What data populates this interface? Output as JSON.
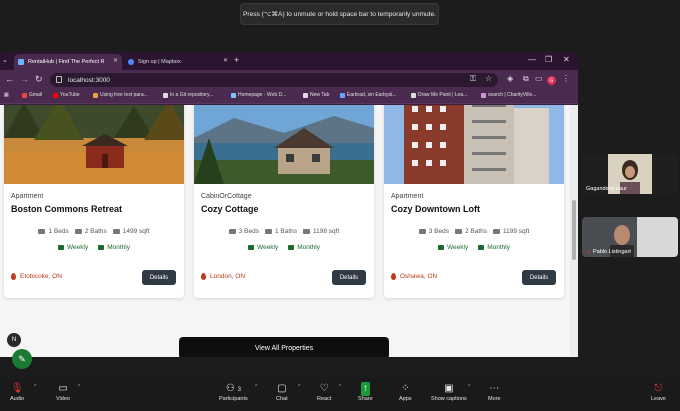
{
  "notification": "Press (⌥⌘A) to unmute or hold space bar to temporarily unmute.",
  "browser": {
    "tabs": [
      {
        "label": "RentalHub | Find The Perfect R",
        "active": true
      },
      {
        "label": "Sign up | Mapbox",
        "active": false
      }
    ],
    "url": "localhost:3000",
    "profile_initial": "G",
    "bookmarks": [
      "Gmail",
      "YouTube",
      "Using free text para...",
      "In a Git repository...",
      "Homepage - Web D...",
      "New Tab",
      "Earbrad, sin Earbyal...",
      "Draw Me Paint | Lea...",
      "search | CharityVille..."
    ]
  },
  "cards": [
    {
      "type": "Apartment",
      "title": "Boston Commons Retreat",
      "beds": "1 Beds",
      "baths": "2 Baths",
      "sqft": "1499 sqft",
      "rate1": "Weekly",
      "rate2": "Monthly",
      "location": "Etobicoke, ON",
      "button": "Details"
    },
    {
      "type": "CabinOrCottage",
      "title": "Cozy Cottage",
      "beds": "3 Beds",
      "baths": "1 Baths",
      "sqft": "1198 sqft",
      "rate1": "Weekly",
      "rate2": "Monthly",
      "location": "London, ON",
      "button": "Details"
    },
    {
      "type": "Apartment",
      "title": "Cozy Downtown Loft",
      "beds": "3 Beds",
      "baths": "2 Baths",
      "sqft": "1199 sqft",
      "rate1": "Weekly",
      "rate2": "Monthly",
      "location": "Oshawa, ON",
      "button": "Details"
    }
  ],
  "view_all": "View All Properties",
  "participants": [
    {
      "name": "Gagandeep kaur"
    },
    {
      "name": "Pablo Listingart"
    }
  ],
  "floating": {
    "n_label": "N"
  },
  "toolbar": {
    "audio": "Audio",
    "video": "Video",
    "participants": "Participants",
    "participants_count": "3",
    "chat": "Chat",
    "react": "React",
    "share": "Share",
    "apps": "Apps",
    "captions": "Show captions",
    "more": "More",
    "leave": "Leave"
  }
}
